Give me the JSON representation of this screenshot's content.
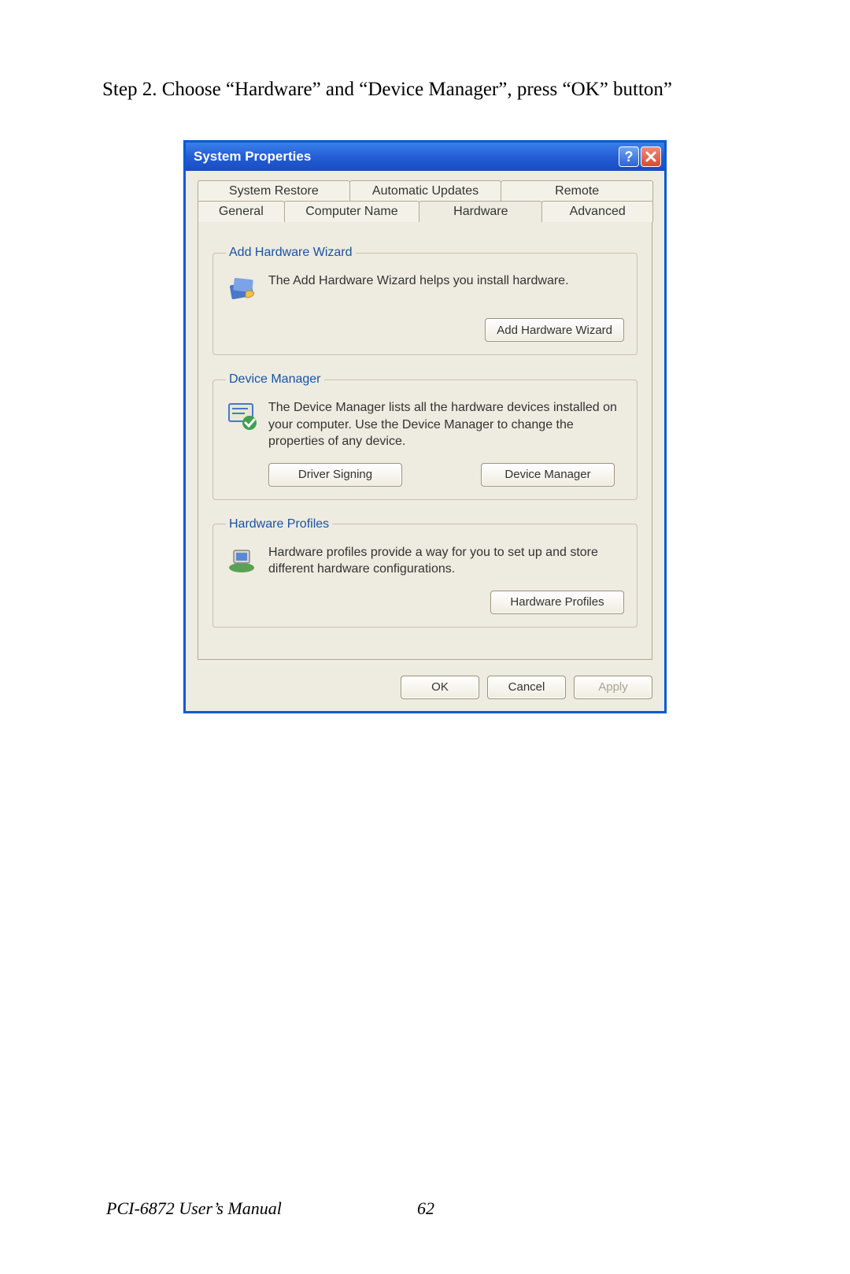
{
  "instruction": "Step 2.  Choose “Hardware” and “Device Manager”, press “OK” button”",
  "window": {
    "title": "System Properties",
    "tabs_row1": {
      "system_restore": "System Restore",
      "automatic_updates": "Automatic Updates",
      "remote": "Remote"
    },
    "tabs_row2": {
      "general": "General",
      "computer_name": "Computer Name",
      "hardware": "Hardware",
      "advanced": "Advanced"
    },
    "groups": {
      "add_hw": {
        "legend": "Add Hardware Wizard",
        "text": "The Add Hardware Wizard helps you install hardware.",
        "btn": "Add Hardware Wizard"
      },
      "devmgr": {
        "legend": "Device Manager",
        "text": "The Device Manager lists all the hardware devices installed on your computer. Use the Device Manager to change the properties of any device.",
        "btn_sign": "Driver Signing",
        "btn_devmgr": "Device Manager"
      },
      "hwprof": {
        "legend": "Hardware Profiles",
        "text": "Hardware profiles provide a way for you to set up and store different hardware configurations.",
        "btn": "Hardware Profiles"
      }
    },
    "dlg": {
      "ok": "OK",
      "cancel": "Cancel",
      "apply": "Apply"
    }
  },
  "footer": {
    "manual": "PCI-6872 User’s Manual",
    "page": "62"
  }
}
